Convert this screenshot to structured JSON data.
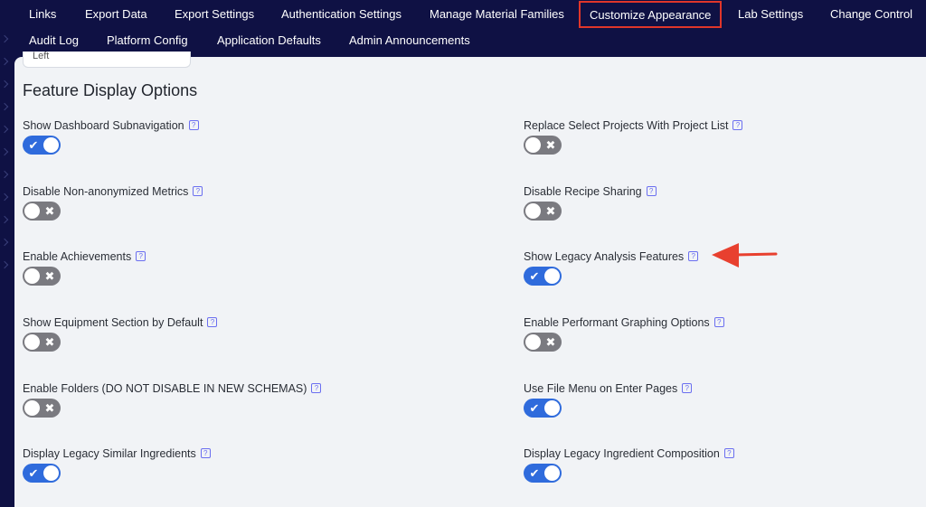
{
  "nav": {
    "row1": [
      "Links",
      "Export Data",
      "Export Settings",
      "Authentication Settings",
      "Manage Material Families",
      "Customize Appearance",
      "Lab Settings",
      "Change Control"
    ],
    "row2": [
      "Audit Log",
      "Platform Config",
      "Application Defaults",
      "Admin Announcements"
    ],
    "active": "Customize Appearance"
  },
  "select": {
    "value": "Left"
  },
  "section": {
    "title": "Feature Display Options"
  },
  "help_glyph": "?",
  "toggle_marks": {
    "on": "✔",
    "off": "✖"
  },
  "options": [
    {
      "label": "Show Dashboard Subnavigation",
      "state": "on"
    },
    {
      "label": "Replace Select Projects With Project List",
      "state": "off"
    },
    {
      "label": "Disable Non-anonymized Metrics",
      "state": "off"
    },
    {
      "label": "Disable Recipe Sharing",
      "state": "off"
    },
    {
      "label": "Enable Achievements",
      "state": "off"
    },
    {
      "label": "Show Legacy Analysis Features",
      "state": "on"
    },
    {
      "label": "Show Equipment Section by Default",
      "state": "off"
    },
    {
      "label": "Enable Performant Graphing Options",
      "state": "off"
    },
    {
      "label": "Enable Folders (DO NOT DISABLE IN NEW SCHEMAS)",
      "state": "off"
    },
    {
      "label": "Use File Menu on Enter Pages",
      "state": "on"
    },
    {
      "label": "Display Legacy Similar Ingredients",
      "state": "on"
    },
    {
      "label": "Display Legacy Ingredient Composition",
      "state": "on"
    }
  ],
  "colors": {
    "nav_bg": "#0f1144",
    "toggle_on": "#2f6bdc",
    "toggle_off": "#7a7a80",
    "highlight": "#e0362a",
    "arrow": "#e8402f"
  }
}
